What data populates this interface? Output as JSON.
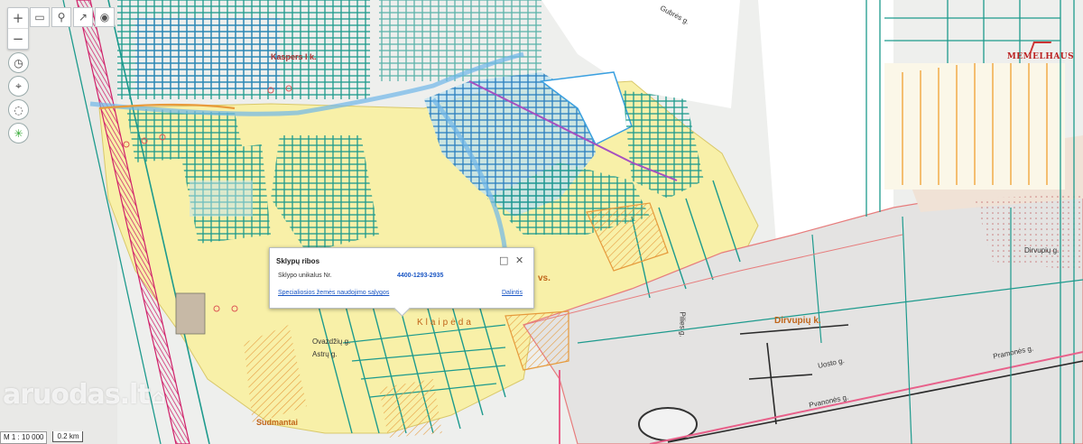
{
  "toolbar": {
    "zoom_in": "+",
    "zoom_out": "−",
    "tools": [
      "ruler-icon",
      "pin-icon",
      "share-icon",
      "target-icon"
    ],
    "side": [
      "history-icon",
      "locate-icon",
      "lasso-icon",
      "loading-icon"
    ]
  },
  "popup": {
    "title": "Sklypų ribos",
    "field_label": "Sklypo unikalus Nr.",
    "field_value": "4400-1293-2935",
    "special_link": "Specialiosios žemės naudojimo sąlygos",
    "share_link": "Dalintis",
    "maximize_icon": "□",
    "close_icon": "✕"
  },
  "scale": {
    "ratio": "M 1 : 10 000",
    "bar": "0.2 km"
  },
  "watermark": "aruodas.lt",
  "logo": "MEMELHAUS",
  "labels": {
    "gubres": "Gubrės g.",
    "kaspers": "Kaspers I k.",
    "ovazdziu": "Ovazdžių g.",
    "astru": "Astrų g.",
    "pilies": "Pilies g.",
    "dirvupiu_g": "Dirvupių g.",
    "uosto": "Uosto g.",
    "pramones": "Pramonės g.",
    "pvanones": "Pvanonės g."
  },
  "places": {
    "dirvupiu_k": "Dirvupių k.",
    "klaipeda": "Klaipėda",
    "vs": "vs.",
    "sudmantai": "Sudmantai"
  },
  "colors": {
    "zone_yellow": "#f8f0a8",
    "parcel_teal": "#1f9f96",
    "highlight_blue": "#3aa0e0",
    "hazard_red": "#e0506a",
    "industrial_gray": "#e3e2e1"
  }
}
